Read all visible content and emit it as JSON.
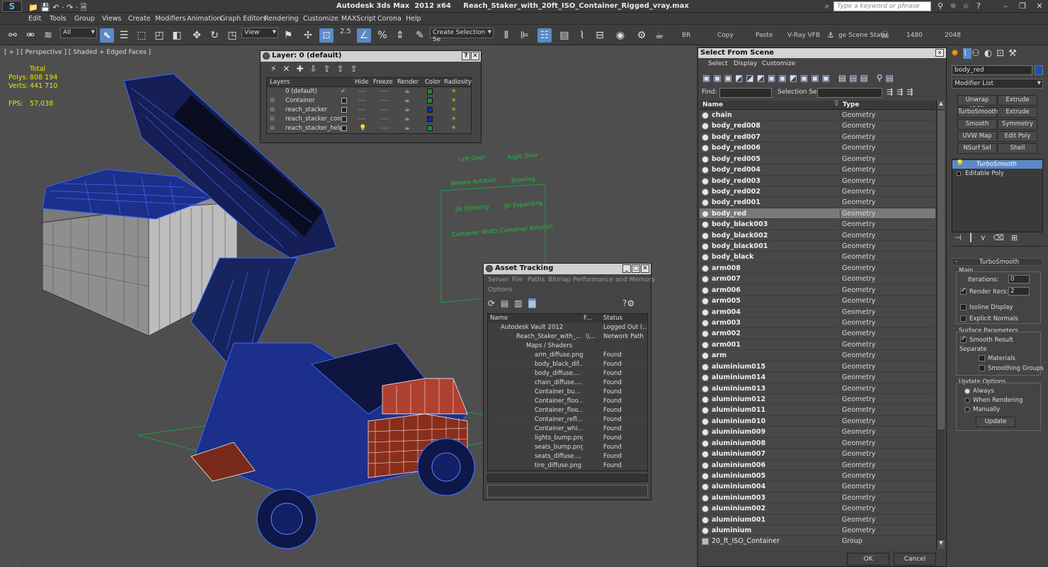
{
  "titlebar": {
    "title": "Autodesk 3ds Max  2012 x64     Reach_Staker_with_20ft_ISO_Container_Rigged_vray.max",
    "search_placeholder": "Type a keyword or phrase"
  },
  "menu": [
    "Edit",
    "Tools",
    "Group",
    "Views",
    "Create",
    "Modifiers",
    "Animation",
    "Graph Editors",
    "Rendering",
    "Customize",
    "MAXScript",
    "Corona",
    "Help"
  ],
  "toolbar": {
    "filter": "All",
    "view": "View",
    "snap_value": "2.5",
    "selection_set": "Create Selection Se",
    "right_labels": [
      "BR",
      "Copy",
      "Paste",
      "V-Ray VFB",
      "ge Scene Stat",
      "1480",
      "2048"
    ]
  },
  "viewport": {
    "label": "[ + ] [ Perspective ] [ Shaded + Edged Faces ]",
    "stats": {
      "total_label": "Total",
      "polys_label": "Polys:",
      "polys": "808 194",
      "verts_label": "Verts:",
      "verts": "441 710",
      "fps_label": "FPS:",
      "fps": "57,038"
    },
    "rig_labels": [
      "Left Door",
      "Right Door",
      "Wheels Rotation",
      "Steering",
      "Jib Climbing",
      "Jib Expanding",
      "Container Width",
      "Container Rotation"
    ]
  },
  "layer_window": {
    "title": "Layer: 0 (default)",
    "columns": [
      "Layers",
      "Hide",
      "Freeze",
      "Render",
      "Color",
      "Radiosity"
    ],
    "rows": [
      {
        "name": "0 (default)",
        "color": "#1e8c3a"
      },
      {
        "name": "Container",
        "color": "#1e8c3a"
      },
      {
        "name": "reach_stacker",
        "color": "#1a2a9a"
      },
      {
        "name": "reach_stacker_cont",
        "color": "#1a2a9a"
      },
      {
        "name": "reach_stacker_help",
        "color": "#1e8c3a"
      }
    ]
  },
  "asset_window": {
    "title": "Asset Tracking",
    "menu1": [
      "Server",
      "File",
      "Paths",
      "Bitmap Performance and Memory"
    ],
    "menu2": [
      "Options"
    ],
    "columns": [
      "Name",
      "F...",
      "Status"
    ],
    "rows": [
      {
        "name": "Autodesk Vault 2012",
        "f": "",
        "status": "Logged Out (..."
      },
      {
        "name": "Reach_Staker_with_...",
        "f": "\\\\...",
        "status": "Network Path"
      },
      {
        "name": "Maps / Shaders",
        "f": "",
        "status": ""
      },
      {
        "name": "arm_diffuse.png",
        "f": "",
        "status": "Found"
      },
      {
        "name": "body_black_dif...",
        "f": "",
        "status": "Found"
      },
      {
        "name": "body_diffuse....",
        "f": "",
        "status": "Found"
      },
      {
        "name": "chain_diffuse....",
        "f": "",
        "status": "Found"
      },
      {
        "name": "Container_bu...",
        "f": "",
        "status": "Found"
      },
      {
        "name": "Container_floo...",
        "f": "",
        "status": "Found"
      },
      {
        "name": "Container_floo...",
        "f": "",
        "status": "Found"
      },
      {
        "name": "Container_refl...",
        "f": "",
        "status": "Found"
      },
      {
        "name": "Container_whi...",
        "f": "",
        "status": "Found"
      },
      {
        "name": "lights_bump.png",
        "f": "",
        "status": "Found"
      },
      {
        "name": "seats_bump.png",
        "f": "",
        "status": "Found"
      },
      {
        "name": "seats_diffuse....",
        "f": "",
        "status": "Found"
      },
      {
        "name": "tire_diffuse.png",
        "f": "",
        "status": "Found"
      }
    ]
  },
  "select_window": {
    "title": "Select From Scene",
    "menu": [
      "Select",
      "Display",
      "Customize"
    ],
    "find_label": "Find:",
    "selset_label": "Selection Set:",
    "columns": [
      "Name",
      "Type"
    ],
    "rows": [
      {
        "name": "chain",
        "type": "Geometry"
      },
      {
        "name": "body_red008",
        "type": "Geometry"
      },
      {
        "name": "body_red007",
        "type": "Geometry"
      },
      {
        "name": "body_red006",
        "type": "Geometry"
      },
      {
        "name": "body_red005",
        "type": "Geometry"
      },
      {
        "name": "body_red004",
        "type": "Geometry"
      },
      {
        "name": "body_red003",
        "type": "Geometry"
      },
      {
        "name": "body_red002",
        "type": "Geometry"
      },
      {
        "name": "body_red001",
        "type": "Geometry"
      },
      {
        "name": "body_red",
        "type": "Geometry"
      },
      {
        "name": "body_black003",
        "type": "Geometry"
      },
      {
        "name": "body_black002",
        "type": "Geometry"
      },
      {
        "name": "body_black001",
        "type": "Geometry"
      },
      {
        "name": "body_black",
        "type": "Geometry"
      },
      {
        "name": "arm008",
        "type": "Geometry"
      },
      {
        "name": "arm007",
        "type": "Geometry"
      },
      {
        "name": "arm006",
        "type": "Geometry"
      },
      {
        "name": "arm005",
        "type": "Geometry"
      },
      {
        "name": "arm004",
        "type": "Geometry"
      },
      {
        "name": "arm003",
        "type": "Geometry"
      },
      {
        "name": "arm002",
        "type": "Geometry"
      },
      {
        "name": "arm001",
        "type": "Geometry"
      },
      {
        "name": "arm",
        "type": "Geometry"
      },
      {
        "name": "aluminium015",
        "type": "Geometry"
      },
      {
        "name": "aluminium014",
        "type": "Geometry"
      },
      {
        "name": "aluminium013",
        "type": "Geometry"
      },
      {
        "name": "aluminium012",
        "type": "Geometry"
      },
      {
        "name": "aluminium011",
        "type": "Geometry"
      },
      {
        "name": "aluminium010",
        "type": "Geometry"
      },
      {
        "name": "aluminium009",
        "type": "Geometry"
      },
      {
        "name": "aluminium008",
        "type": "Geometry"
      },
      {
        "name": "aluminium007",
        "type": "Geometry"
      },
      {
        "name": "aluminium006",
        "type": "Geometry"
      },
      {
        "name": "aluminium005",
        "type": "Geometry"
      },
      {
        "name": "aluminium004",
        "type": "Geometry"
      },
      {
        "name": "aluminium003",
        "type": "Geometry"
      },
      {
        "name": "aluminium002",
        "type": "Geometry"
      },
      {
        "name": "aluminium001",
        "type": "Geometry"
      },
      {
        "name": "aluminium",
        "type": "Geometry"
      },
      {
        "name": "20_ft_ISO_Container",
        "type": "Group"
      }
    ],
    "selected": "body_red",
    "ok": "OK",
    "cancel": "Cancel"
  },
  "command_panel": {
    "object_name": "body_red",
    "modifier_list": "Modifier List",
    "mod_buttons": [
      "Unwrap UVW",
      "Extrude",
      "TurboSmooth",
      "Extrude",
      "Smooth",
      "Symmetry",
      "UVW Map",
      "Edit Poly",
      "NSurf Sel",
      "Shell"
    ],
    "stack": [
      "TurboSmooth",
      "Editable Poly"
    ],
    "rollout_title": "TurboSmooth",
    "main_label": "Main",
    "iterations_label": "Iterations:",
    "iterations": "0",
    "render_iters_label": "Render Iters:",
    "render_iters": "2",
    "isoline": "Isoline Display",
    "explicit_normals": "Explicit Normals",
    "surface_params": "Surface Parameters",
    "smooth_result": "Smooth Result",
    "separate": "Separate",
    "materials": "Materials",
    "smoothing_groups": "Smoothing Groups",
    "update_options": "Update Options",
    "always": "Always",
    "when_rendering": "When Rendering",
    "manually": "Manually",
    "update_button": "Update"
  }
}
